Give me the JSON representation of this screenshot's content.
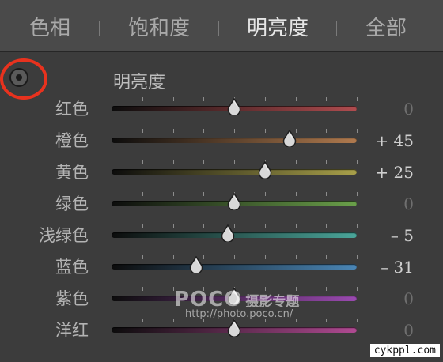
{
  "tabs": [
    {
      "label": "色相",
      "active": false
    },
    {
      "label": "饱和度",
      "active": false
    },
    {
      "label": "明亮度",
      "active": true
    },
    {
      "label": "全部",
      "active": false
    }
  ],
  "section_title": "明亮度",
  "sliders": [
    {
      "label": "红色",
      "value_text": "0",
      "value": 0,
      "track_color": "#b04c4f"
    },
    {
      "label": "橙色",
      "value_text": "+ 45",
      "value": 45,
      "track_color": "#b07a4e"
    },
    {
      "label": "黄色",
      "value_text": "+ 25",
      "value": 25,
      "track_color": "#a8a04a"
    },
    {
      "label": "绿色",
      "value_text": "0",
      "value": 0,
      "track_color": "#6aa04a"
    },
    {
      "label": "浅绿色",
      "value_text": "– 5",
      "value": -5,
      "track_color": "#4aa69a"
    },
    {
      "label": "蓝色",
      "value_text": "– 31",
      "value": -31,
      "track_color": "#4a86b6"
    },
    {
      "label": "紫色",
      "value_text": "0",
      "value": 0,
      "track_color": "#9a4ab0"
    },
    {
      "label": "洋红",
      "value_text": "0",
      "value": 0,
      "track_color": "#b04a92"
    }
  ],
  "slider_range": [
    -100,
    100
  ],
  "watermark": {
    "logo": "POCO",
    "chinese": "摄影专题",
    "url": "http://photo.poco.cn/"
  },
  "corner_mark": "cykppl.com",
  "colors": {
    "highlight_ring": "#e8321e",
    "panel_bg": "#3c3c3c",
    "tab_bar_bg": "#4a4a4a"
  },
  "icons": {
    "target_adjustment": "target-adjustment-icon",
    "slider_thumb": "slider-thumb-icon"
  }
}
